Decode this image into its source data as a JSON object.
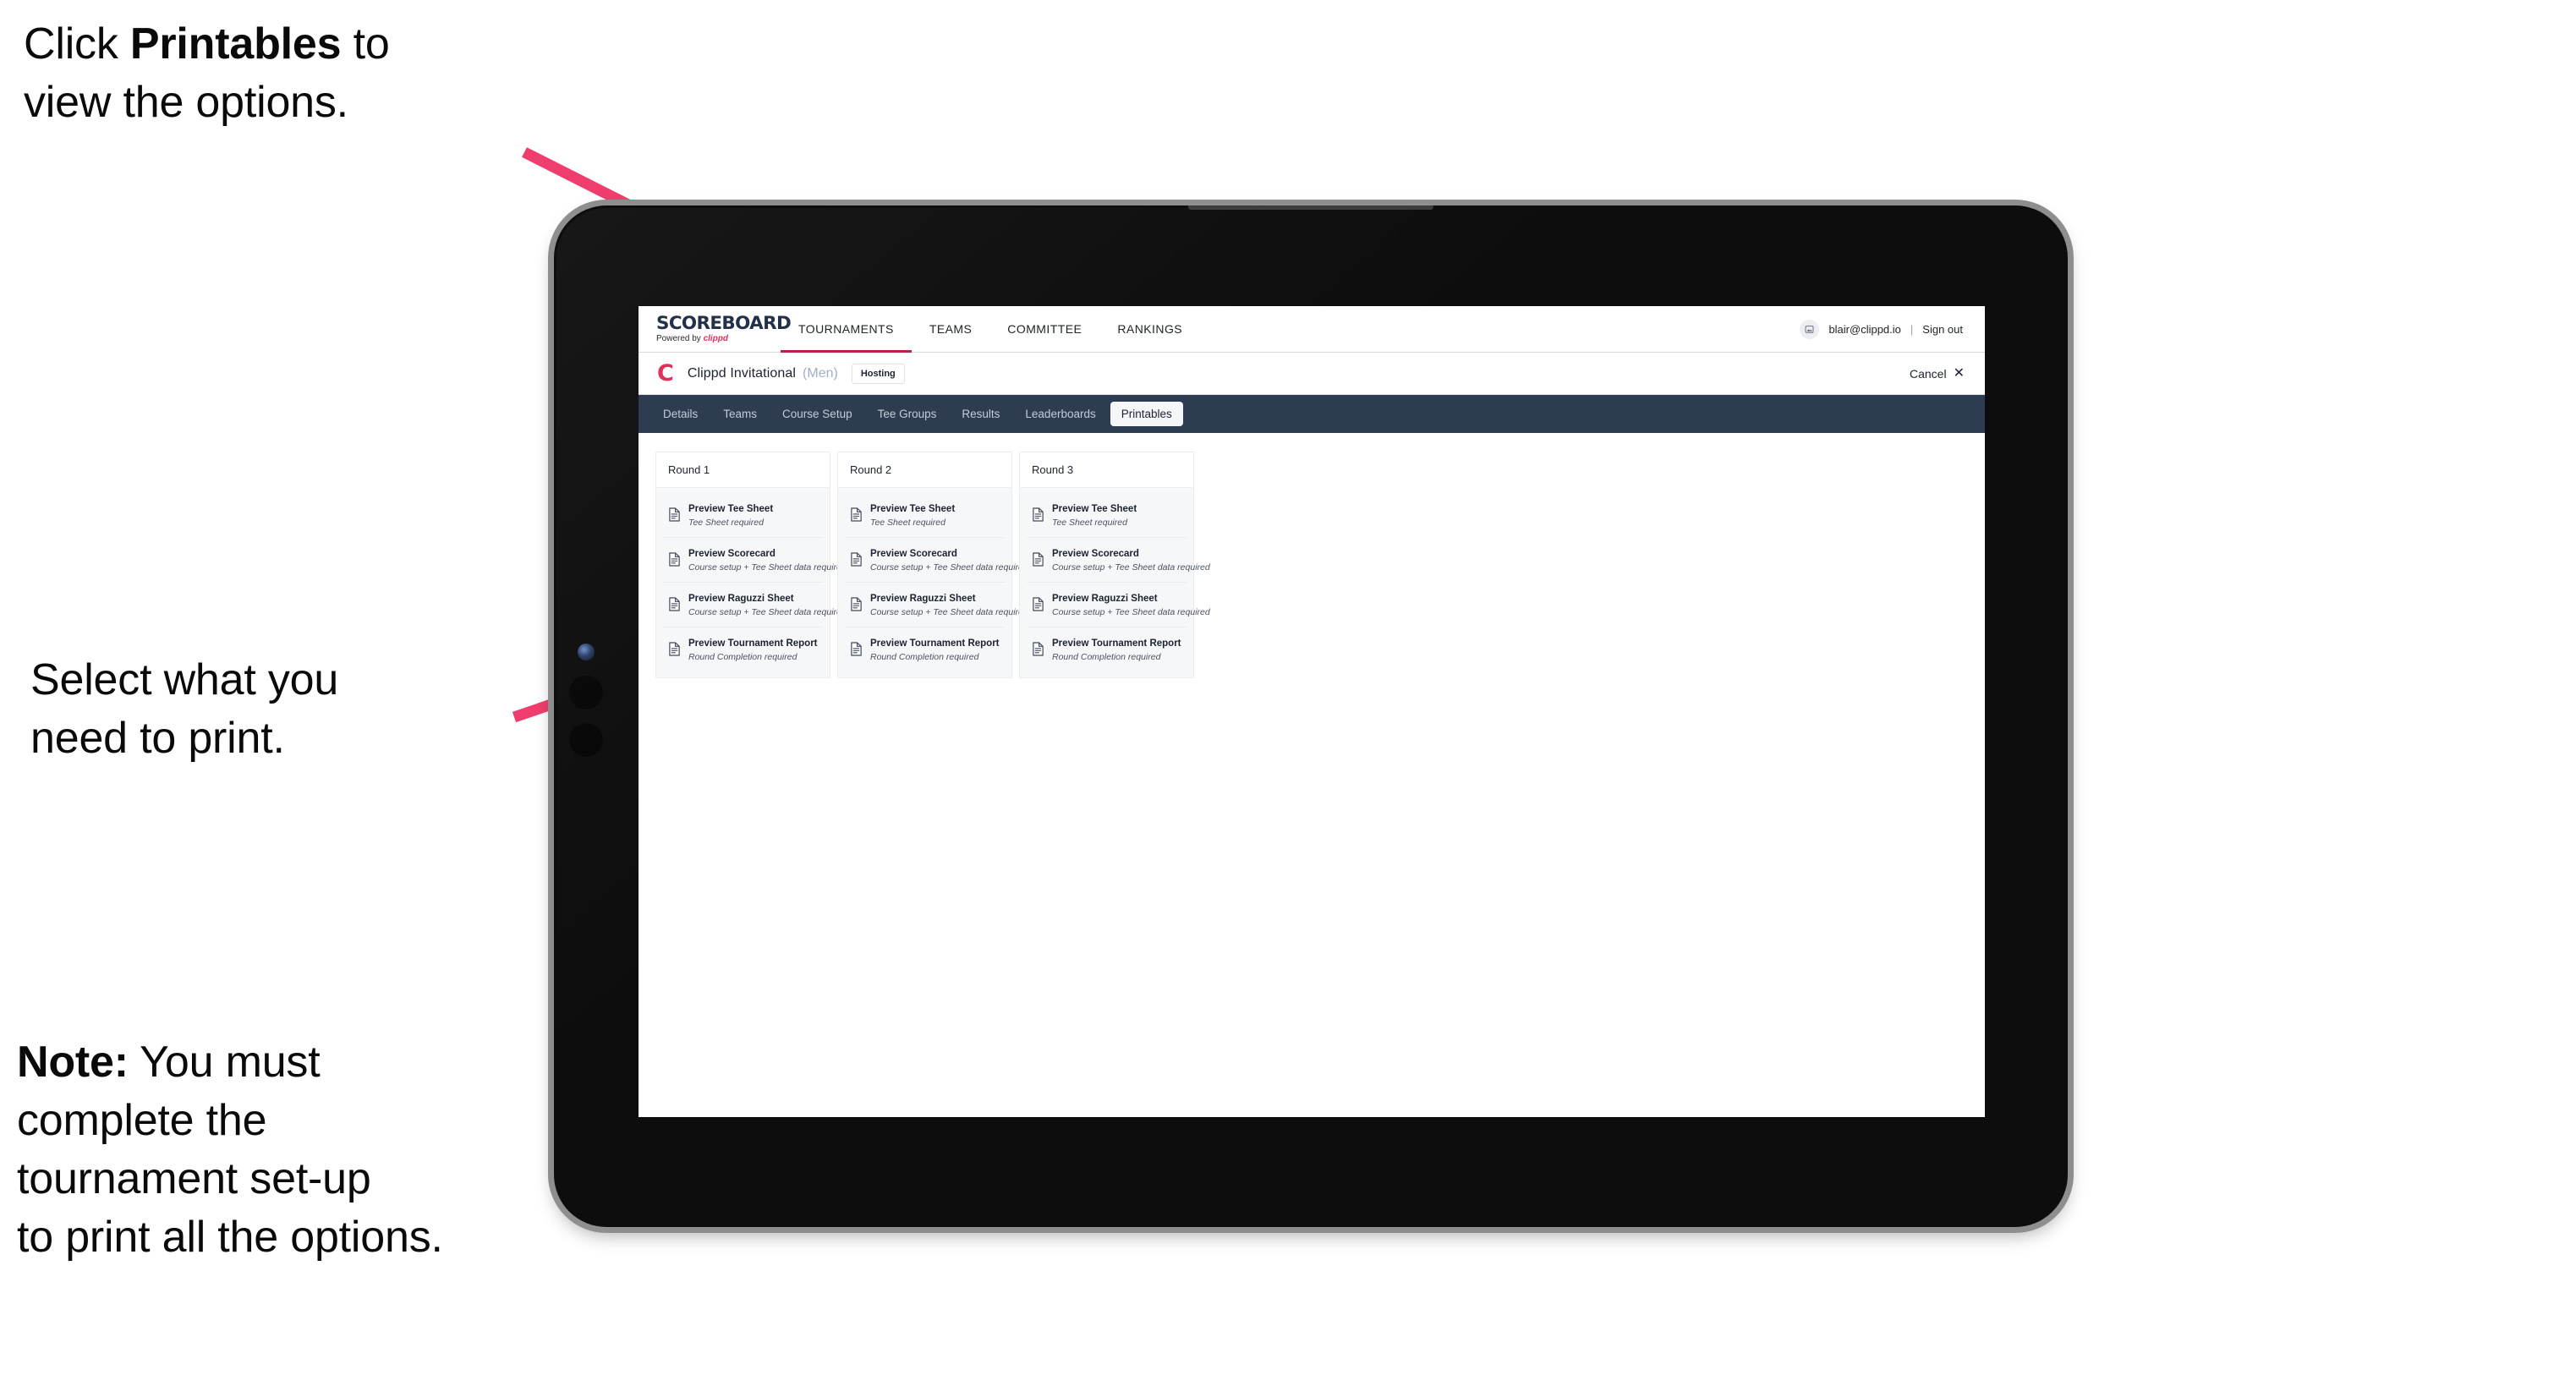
{
  "annotations": {
    "click_printables": {
      "prefix": "Click ",
      "bold": "Printables",
      "suffix": " to\nview the options."
    },
    "select_print": "Select what you\n need to print.",
    "note": {
      "bold": "Note:",
      "rest": " You must\ncomplete the\ntournament set-up\nto print all the options."
    }
  },
  "colors": {
    "accent_pink": "#ef3e6d",
    "brand_crimson": "#e0315b",
    "nav_active_underline": "#b4244a",
    "section_bar_navy": "#2e3c51",
    "tab_active_bg": "#f4f6f8",
    "card_body_bg": "#f6f7f8"
  },
  "browser": {
    "global_nav": {
      "brand": {
        "wordmark": "SCOREBOARD",
        "powered_by_prefix": "Powered by ",
        "powered_by_brand": "clippd"
      },
      "items": [
        {
          "label": "TOURNAMENTS",
          "active": true
        },
        {
          "label": "TEAMS",
          "active": false
        },
        {
          "label": "COMMITTEE",
          "active": false
        },
        {
          "label": "RANKINGS",
          "active": false
        }
      ],
      "account": {
        "avatar_icon": "user-avatar-icon",
        "email": "blair@clippd.io",
        "separator": "|",
        "sign_out_label": "Sign out"
      }
    },
    "tournament_header": {
      "logo_letter": "C",
      "name": "Clippd Invitational",
      "gender": "(Men)",
      "status_badge": "Hosting",
      "cancel_label": "Cancel",
      "cancel_icon": "close-icon"
    },
    "section_tabs": [
      {
        "label": "Details",
        "active": false
      },
      {
        "label": "Teams",
        "active": false
      },
      {
        "label": "Course Setup",
        "active": false
      },
      {
        "label": "Tee Groups",
        "active": false
      },
      {
        "label": "Results",
        "active": false
      },
      {
        "label": "Leaderboards",
        "active": false
      },
      {
        "label": "Printables",
        "active": true
      }
    ],
    "printables": {
      "rounds": [
        {
          "title": "Round 1",
          "items": [
            {
              "title": "Preview Tee Sheet",
              "requirement": "Tee Sheet required"
            },
            {
              "title": "Preview Scorecard",
              "requirement": "Course setup + Tee Sheet data required"
            },
            {
              "title": "Preview Raguzzi Sheet",
              "requirement": "Course setup + Tee Sheet data required"
            },
            {
              "title": "Preview Tournament Report",
              "requirement": "Round Completion required"
            }
          ]
        },
        {
          "title": "Round 2",
          "items": [
            {
              "title": "Preview Tee Sheet",
              "requirement": "Tee Sheet required"
            },
            {
              "title": "Preview Scorecard",
              "requirement": "Course setup + Tee Sheet data required"
            },
            {
              "title": "Preview Raguzzi Sheet",
              "requirement": "Course setup + Tee Sheet data required"
            },
            {
              "title": "Preview Tournament Report",
              "requirement": "Round Completion required"
            }
          ]
        },
        {
          "title": "Round 3",
          "items": [
            {
              "title": "Preview Tee Sheet",
              "requirement": "Tee Sheet required"
            },
            {
              "title": "Preview Scorecard",
              "requirement": "Course setup + Tee Sheet data required"
            },
            {
              "title": "Preview Raguzzi Sheet",
              "requirement": "Course setup + Tee Sheet data required"
            },
            {
              "title": "Preview Tournament Report",
              "requirement": "Round Completion required"
            }
          ]
        }
      ],
      "item_icon": "document-icon"
    }
  },
  "device": {
    "type": "tablet",
    "camera_icon": "camera-lens-icon",
    "buttons": [
      "side-button-volume-up",
      "side-button-volume-down"
    ]
  }
}
